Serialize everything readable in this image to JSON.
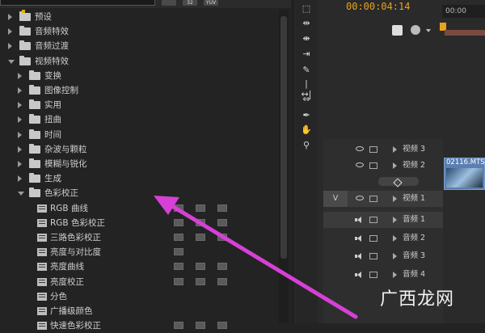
{
  "effects_panel": {
    "top_buttons": [
      "",
      "32",
      "YUV"
    ],
    "tree": [
      {
        "label": "预设",
        "level": 0,
        "expanded": false,
        "type": "folder",
        "preset": true
      },
      {
        "label": "音频特效",
        "level": 0,
        "expanded": false,
        "type": "folder"
      },
      {
        "label": "音频过渡",
        "level": 0,
        "expanded": false,
        "type": "folder"
      },
      {
        "label": "视频特效",
        "level": 0,
        "expanded": true,
        "type": "folder"
      },
      {
        "label": "变换",
        "level": 1,
        "expanded": false,
        "type": "folder"
      },
      {
        "label": "图像控制",
        "level": 1,
        "expanded": false,
        "type": "folder"
      },
      {
        "label": "实用",
        "level": 1,
        "expanded": false,
        "type": "folder"
      },
      {
        "label": "扭曲",
        "level": 1,
        "expanded": false,
        "type": "folder"
      },
      {
        "label": "时间",
        "level": 1,
        "expanded": false,
        "type": "folder"
      },
      {
        "label": "杂波与颗粒",
        "level": 1,
        "expanded": false,
        "type": "folder"
      },
      {
        "label": "模糊与锐化",
        "level": 1,
        "expanded": false,
        "type": "folder"
      },
      {
        "label": "生成",
        "level": 1,
        "expanded": false,
        "type": "folder"
      },
      {
        "label": "色彩校正",
        "level": 1,
        "expanded": true,
        "type": "folder"
      },
      {
        "label": "RGB 曲线",
        "level": 2,
        "type": "effect",
        "badges": 3
      },
      {
        "label": "RGB 色彩校正",
        "level": 2,
        "type": "effect",
        "badges": 3
      },
      {
        "label": "三路色彩校正",
        "level": 2,
        "type": "effect",
        "badges": 3
      },
      {
        "label": "亮度与对比度",
        "level": 2,
        "type": "effect",
        "badges": 1
      },
      {
        "label": "亮度曲线",
        "level": 2,
        "type": "effect",
        "badges": 3
      },
      {
        "label": "亮度校正",
        "level": 2,
        "type": "effect",
        "badges": 3
      },
      {
        "label": "分色",
        "level": 2,
        "type": "effect",
        "badges": 0
      },
      {
        "label": "广播级颜色",
        "level": 2,
        "type": "effect",
        "badges": 0
      },
      {
        "label": "快速色彩校正",
        "level": 2,
        "type": "effect",
        "badges": 3
      }
    ]
  },
  "tools": [
    "⬚",
    "⇹",
    "⇼",
    "⇥",
    "✎",
    "|↔|",
    "⇔",
    "✒",
    "✋",
    "⚲"
  ],
  "timeline": {
    "timecode": "00:00:04:14",
    "ruler_time": "00:00",
    "tracks": [
      {
        "name": "视频 3",
        "kind": "video",
        "selected": false
      },
      {
        "name": "视频 2",
        "kind": "video",
        "selected": false
      },
      {
        "name": "视频 1",
        "kind": "video",
        "selected": true,
        "target": "V"
      },
      {
        "name": "音频 1",
        "kind": "audio",
        "selected": true
      },
      {
        "name": "音频 2",
        "kind": "audio",
        "selected": false
      },
      {
        "name": "音频 3",
        "kind": "audio",
        "selected": false
      },
      {
        "name": "音频 4",
        "kind": "audio",
        "selected": false
      }
    ],
    "clip_name": "02116.MTS"
  },
  "watermark": "广西龙网",
  "colors": {
    "accent": "#e8a21e",
    "arrow": "#d640d6"
  }
}
